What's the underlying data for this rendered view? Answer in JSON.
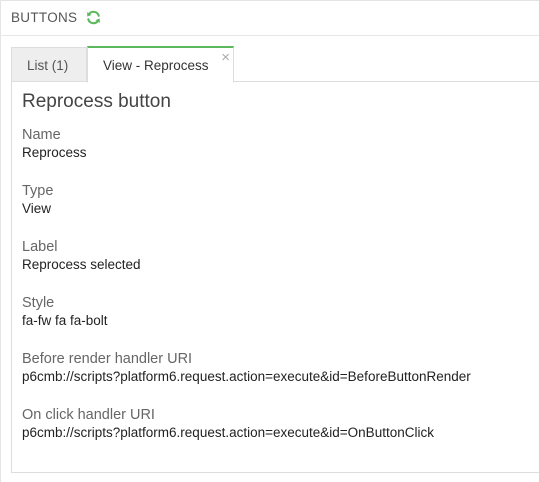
{
  "header": {
    "title": "BUTTONS",
    "refresh_icon": "refresh-icon",
    "accent": "#5cb85c"
  },
  "tabs": [
    {
      "label": "List (1)"
    },
    {
      "label": "View - Reprocess",
      "close": "×"
    }
  ],
  "panel": {
    "title": "Reprocess button",
    "fields": [
      {
        "label": "Name",
        "value": "Reprocess"
      },
      {
        "label": "Type",
        "value": "View"
      },
      {
        "label": "Label",
        "value": "Reprocess selected"
      },
      {
        "label": "Style",
        "value": "fa-fw fa fa-bolt"
      },
      {
        "label": "Before render handler URI",
        "value": "p6cmb://scripts?platform6.request.action=execute&id=BeforeButtonRender"
      },
      {
        "label": "On click handler URI",
        "value": "p6cmb://scripts?platform6.request.action=execute&id=OnButtonClick"
      }
    ]
  }
}
